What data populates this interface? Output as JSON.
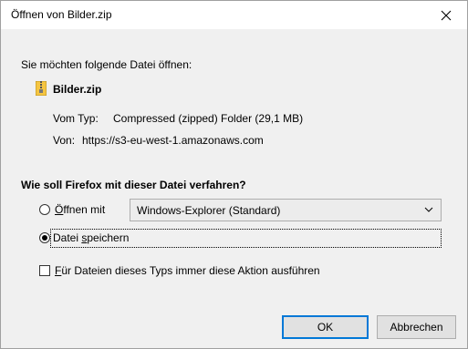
{
  "window": {
    "title": "Öffnen von Bilder.zip"
  },
  "intro": "Sie möchten folgende Datei öffnen:",
  "file": {
    "name": "Bilder.zip",
    "type_label": "Vom Typ:",
    "type_value": "Compressed (zipped) Folder (29,1 MB)",
    "from_label": "Von:",
    "from_value": "https://s3-eu-west-1.amazonaws.com"
  },
  "question": "Wie soll Firefox mit dieser Datei verfahren?",
  "options": {
    "open_with_label_first": "Ö",
    "open_with_label_rest": "ffnen mit",
    "open_with_app": "Windows-Explorer (Standard)",
    "save_label_pre": "Datei ",
    "save_label_ul": "s",
    "save_label_post": "peichern",
    "always_ul": "F",
    "always_rest": "ür Dateien dieses Typs immer diese Aktion ausführen"
  },
  "selected_option": "save",
  "always_checked": false,
  "buttons": {
    "ok": "OK",
    "cancel": "Abbrechen"
  }
}
